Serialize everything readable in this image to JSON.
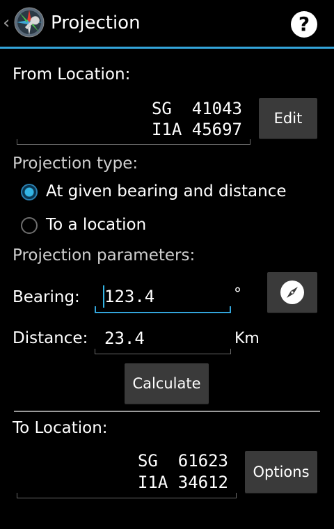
{
  "actionbar": {
    "back_glyph": "‹",
    "app_icon": "compass-wrench-app-icon",
    "title": "Projection",
    "help_glyph": "?"
  },
  "from": {
    "label": "From Location:",
    "line1": "SG  41043",
    "line2": "I1A 45697",
    "edit_label": "Edit"
  },
  "projection_type": {
    "label": "Projection type:",
    "options": [
      {
        "label": "At given bearing and distance",
        "selected": true
      },
      {
        "label": "To a location",
        "selected": false
      }
    ]
  },
  "params": {
    "label": "Projection parameters:",
    "bearing_label": "Bearing:",
    "bearing_value": "123.4",
    "bearing_unit": "°",
    "distance_label": "Distance:",
    "distance_value": "23.4",
    "distance_unit": "Km",
    "calculate_label": "Calculate",
    "compass_icon": "compass-icon"
  },
  "to": {
    "label": "To Location:",
    "line1": "SG  61623",
    "line2": "I1A 34612",
    "options_label": "Options"
  },
  "colors": {
    "accent": "#33a5db",
    "button": "#3a3a3a",
    "background": "#000000"
  }
}
